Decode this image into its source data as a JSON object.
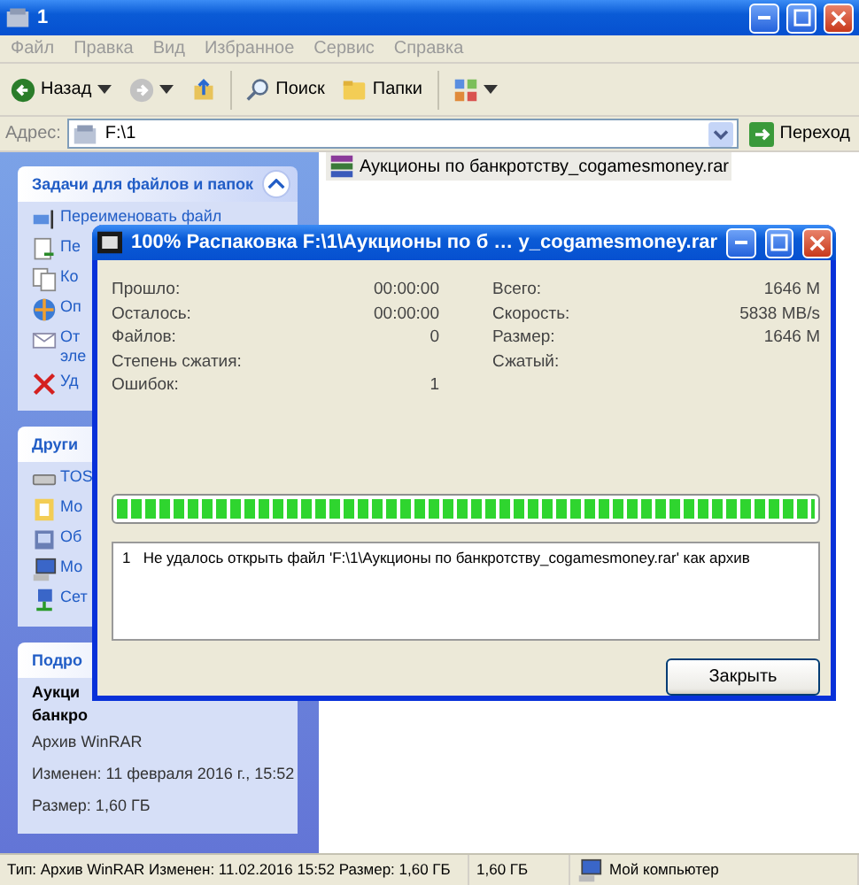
{
  "window": {
    "title": "1"
  },
  "menu": [
    "Файл",
    "Правка",
    "Вид",
    "Избранное",
    "Сервис",
    "Справка"
  ],
  "toolbar": [
    {
      "kind": "back",
      "label": "Назад"
    },
    {
      "kind": "forward"
    },
    {
      "kind": "up"
    },
    {
      "kind": "search",
      "label": "Поиск"
    },
    {
      "kind": "folders",
      "label": "Папки"
    },
    {
      "kind": "views"
    }
  ],
  "address": {
    "label": "Адрес:",
    "value": "F:\\1",
    "go": "Переход"
  },
  "sidebar": {
    "panels": [
      {
        "title": "Задачи для файлов и папок",
        "expanded": true,
        "items": [
          {
            "kind": "rename",
            "label": "Переименовать файл"
          },
          {
            "kind": "move",
            "label": "Пе"
          },
          {
            "kind": "copy",
            "label": "Ко"
          },
          {
            "kind": "web",
            "label": "Оп"
          },
          {
            "kind": "mail",
            "label": "От",
            "continuation": "эле"
          },
          {
            "kind": "delete",
            "label": "Уд"
          }
        ]
      },
      {
        "title": "Други",
        "items": [
          {
            "kind": "drive",
            "label": "TOS"
          },
          {
            "kind": "docs",
            "label": "Мо"
          },
          {
            "kind": "shared",
            "label": "Об"
          },
          {
            "kind": "computer",
            "label": "Мо"
          },
          {
            "kind": "network",
            "label": "Сет"
          }
        ]
      },
      {
        "title": "Подро",
        "details": [
          {
            "kind": "bold",
            "text": "Аукци"
          },
          {
            "kind": "bold",
            "text": "банкро"
          },
          {
            "kind": "plain",
            "text": "Архив WinRAR"
          },
          {
            "kind": "plain",
            "text": "Изменен: 11 февраля 2016 г., 15:52"
          },
          {
            "kind": "plain",
            "text": "Размер: 1,60 ГБ"
          }
        ]
      }
    ]
  },
  "files": [
    {
      "name": "Аукционы по банкротству_cogamesmoney.rar",
      "selected": true
    }
  ],
  "dialog": {
    "title": "100% Распаковка F:\\1\\Аукционы по б … у_cogamesmoney.rar",
    "stats_left": [
      {
        "label": "Прошло:",
        "value": "00:00:00"
      },
      {
        "label": "Осталось:",
        "value": "00:00:00"
      },
      {
        "label": "Файлов:",
        "value": "0"
      },
      {
        "label": "Степень сжатия:"
      },
      {
        "label": "Ошибок:",
        "value": "1"
      }
    ],
    "stats_right": [
      {
        "label": "Всего:",
        "value": "1646 M"
      },
      {
        "label": "Скорость:",
        "value": "5838 MB/s"
      },
      {
        "label": "Размер:",
        "value": "1646 M"
      },
      {
        "label": "Сжатый:"
      }
    ],
    "progress": {
      "level": 1
    },
    "log": [
      {
        "number": "1",
        "text": "Не удалось открыть файл 'F:\\1\\Аукционы по банкротству_cogamesmoney.rar' как архив"
      }
    ],
    "button": "Закрыть"
  },
  "status_bar": [
    {
      "kind": "text",
      "text": "Тип: Архив WinRAR Изменен: 11.02.2016 15:52 Размер: 1,60 ГБ"
    },
    {
      "kind": "text",
      "text": "1,60 ГБ"
    },
    {
      "kind": "zone",
      "text": "Мой компьютер"
    }
  ]
}
